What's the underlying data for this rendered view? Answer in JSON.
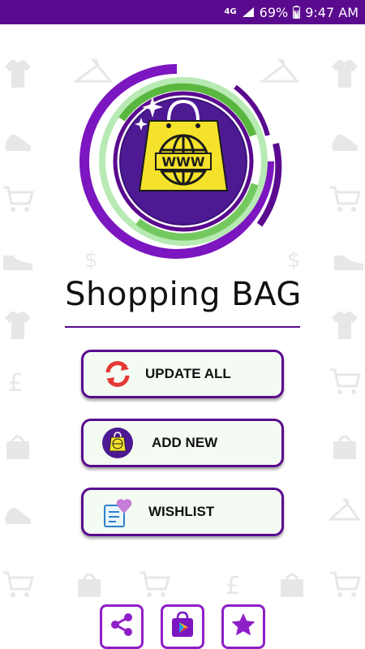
{
  "status_bar": {
    "network": "4G",
    "battery_percent": "69%",
    "time": "9:47 AM"
  },
  "logo": {
    "globe_text": "WWW",
    "icon": "shopping-bag-globe-icon"
  },
  "app": {
    "title": "Shopping BAG"
  },
  "menu": {
    "update_all": {
      "label": "UPDATE ALL",
      "icon": "refresh-icon"
    },
    "add_new": {
      "label": "ADD NEW",
      "icon": "shopping-bag-icon"
    },
    "wishlist": {
      "label": "WISHLIST",
      "icon": "wishlist-heart-icon"
    }
  },
  "bottom_bar": {
    "share": {
      "icon": "share-icon"
    },
    "store": {
      "icon": "play-store-icon"
    },
    "rate": {
      "icon": "star-icon"
    }
  },
  "colors": {
    "primary": "#5a0a8e",
    "accent": "#8e1fc7",
    "green": "#5cc85a",
    "button_bg": "#f3fbf3",
    "bag_yellow": "#f5e22a"
  }
}
